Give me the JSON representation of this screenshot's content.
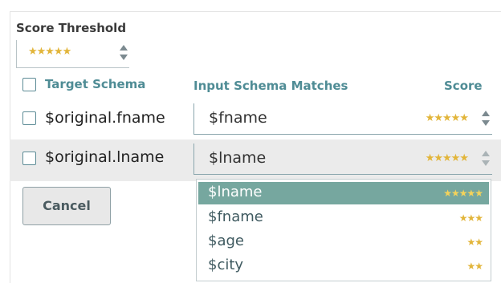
{
  "threshold": {
    "label": "Score Threshold",
    "value_stars": "★★★★★"
  },
  "headers": {
    "target": "Target Schema",
    "input": "Input Schema Matches",
    "score": "Score"
  },
  "rows": [
    {
      "target": "$original.fname",
      "match": "$fname",
      "stars": "★★★★★"
    },
    {
      "target": "$original.lname",
      "match": "$lname",
      "stars": "★★★★★"
    }
  ],
  "cancel_label": "Cancel",
  "dropdown": {
    "options": [
      {
        "label": "$lname",
        "stars": "★★★★★",
        "selected": true
      },
      {
        "label": "$fname",
        "stars": "★★★"
      },
      {
        "label": "$age",
        "stars": "★★"
      },
      {
        "label": "$city",
        "stars": "★★"
      }
    ]
  },
  "colors": {
    "accent": "#4f8c95",
    "selected": "#76a79f",
    "star": "#e2b53a"
  }
}
